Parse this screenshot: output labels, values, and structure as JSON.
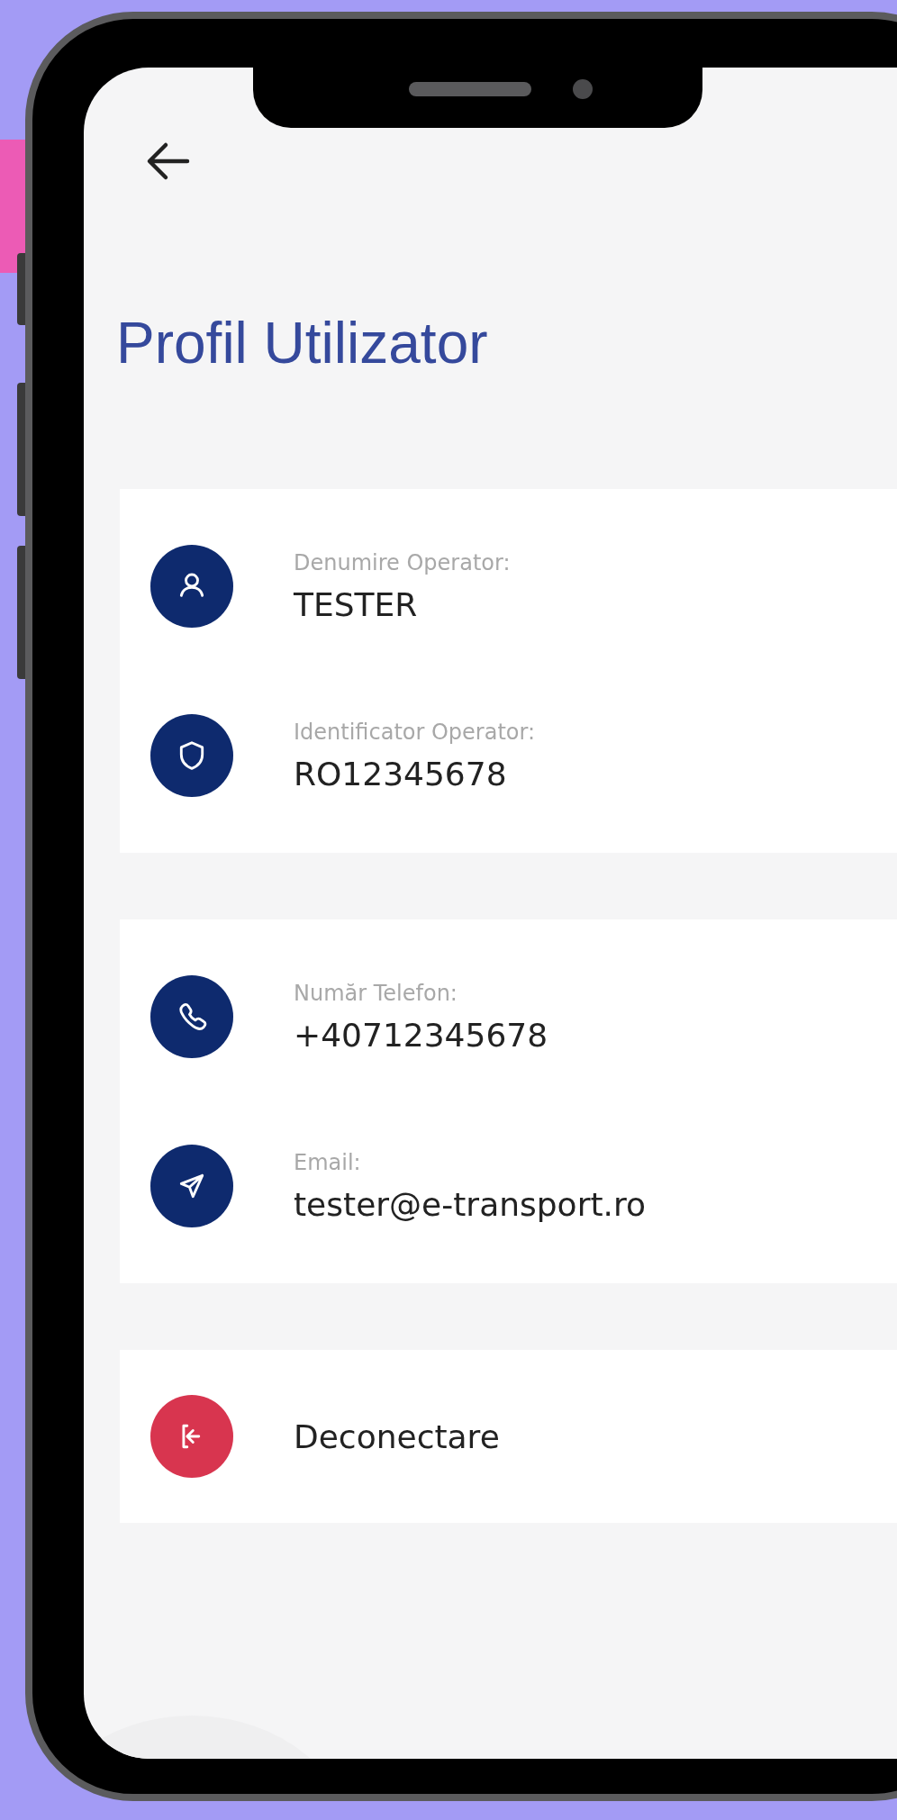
{
  "header": {
    "title": "Profil Utilizator"
  },
  "cards": [
    {
      "items": [
        {
          "kind": "field",
          "label": "Denumire Operator:",
          "value": "TESTER"
        },
        {
          "kind": "field",
          "label": "Identificator Operator:",
          "value": "RO12345678"
        }
      ]
    },
    {
      "items": [
        {
          "kind": "field",
          "label": "Număr Telefon:",
          "value": "+40712345678"
        },
        {
          "kind": "field",
          "label": "Email:",
          "value": "tester@e-transport.ro"
        }
      ]
    },
    {
      "items": [
        {
          "kind": "action",
          "value": "Deconectare"
        }
      ]
    }
  ]
}
